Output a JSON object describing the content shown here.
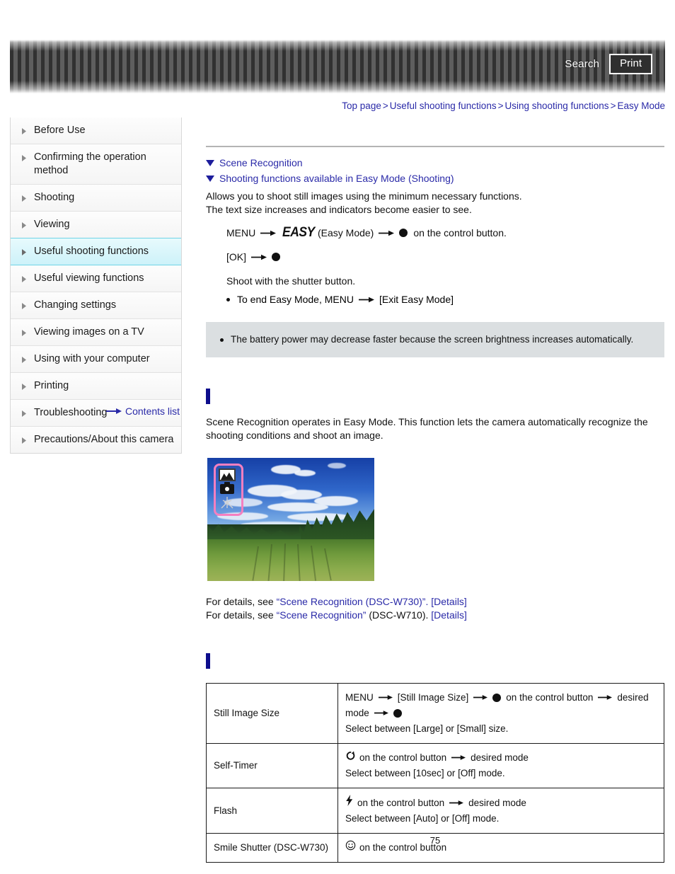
{
  "header": {
    "search_label": "Search",
    "print_label": "Print",
    "search_icon": "search-icon",
    "print_icon": "print-icon"
  },
  "breadcrumb": {
    "items": [
      {
        "label": "Top page"
      },
      {
        "label": "Useful shooting functions"
      },
      {
        "label": "Using shooting functions"
      },
      {
        "label": "Easy Mode"
      }
    ],
    "separator": ">"
  },
  "sidebar": {
    "items": [
      {
        "label": "Before Use",
        "active": false
      },
      {
        "label": "Confirming the operation method",
        "active": false
      },
      {
        "label": "Shooting",
        "active": false
      },
      {
        "label": "Viewing",
        "active": false
      },
      {
        "label": "Useful shooting functions",
        "active": true
      },
      {
        "label": "Useful viewing functions",
        "active": false
      },
      {
        "label": "Changing settings",
        "active": false
      },
      {
        "label": "Viewing images on a TV",
        "active": false
      },
      {
        "label": "Using with your computer",
        "active": false
      },
      {
        "label": "Printing",
        "active": false
      },
      {
        "label": "Troubleshooting",
        "active": false
      },
      {
        "label": "Precautions/About this camera",
        "active": false
      }
    ],
    "contents_list_label": "Contents list",
    "contents_list_icon": "right-arrow-icon"
  },
  "main": {
    "page_title": "",
    "jump_links": [
      {
        "label": "Scene Recognition",
        "icon": "triangle-down-icon"
      },
      {
        "label": "Shooting functions available in Easy Mode (Shooting)",
        "icon": "triangle-down-icon"
      }
    ],
    "intro": {
      "line1": "Allows you to shoot still images using the minimum necessary functions.",
      "line2": "The text size increases and indicators become easier to see."
    },
    "steps": {
      "step1_pre": "MENU",
      "step1_logo": "EASY",
      "step1_mid": "(Easy Mode)",
      "step1_post": "on the control button.",
      "step2_pre": "[OK]",
      "shoot_text": "Shoot with the shutter button.",
      "exit_pre": "To end Easy Mode, MENU",
      "exit_post": "[Exit Easy Mode]"
    },
    "note": "The battery power may decrease faster because the screen brightness increases automatically.",
    "section1": {
      "title": "",
      "paragraph": "Scene Recognition operates in Easy Mode. This function lets the camera automatically recognize the shooting conditions and shoot an image.",
      "screenshot_icons": [
        "landscape-icon",
        "camera-icon",
        "tripod-icon"
      ],
      "details_line1": {
        "prefix": "For details, see",
        "link": "“Scene Recognition (DSC-W730)”.",
        "details_link": "[Details]"
      },
      "details_line2": {
        "prefix": "For details, see",
        "link": "“Scene Recognition”",
        "middle": "(DSC-W710).",
        "details_link": "[Details]"
      }
    },
    "section2": {
      "title": "",
      "table": {
        "rows": [
          {
            "name": "Still Image Size",
            "icon": "",
            "line1_a": "MENU",
            "line1_b": "[Still Image Size]",
            "line1_c": "on the control button",
            "line1_d": "desired",
            "line2_a": "mode",
            "line3": "Select between [Large] or [Small] size."
          },
          {
            "name": "Self-Timer",
            "icon": "self-timer-icon",
            "line1_a": "on the control button",
            "line1_b": "desired mode",
            "line3": "Select between [10sec] or [Off] mode."
          },
          {
            "name": "Flash",
            "icon": "flash-icon",
            "line1_a": "on the control button",
            "line1_b": "desired mode",
            "line3": "Select between [Auto] or [Off] mode."
          },
          {
            "name": "Smile Shutter (DSC-W730)",
            "icon": "smile-shutter-icon",
            "line1_a": "on the control button",
            "line1_b": "",
            "line3": ""
          }
        ]
      }
    }
  },
  "footer": {
    "page_number": "75"
  },
  "colors": {
    "link": "#2a2aa8",
    "accent_bar": "#0d0d8c",
    "active_item_bg": "#cdf2f9",
    "active_item_border": "#6fd4e6",
    "note_bg": "#dbdfe1",
    "callout_pink": "#f47fc0"
  }
}
